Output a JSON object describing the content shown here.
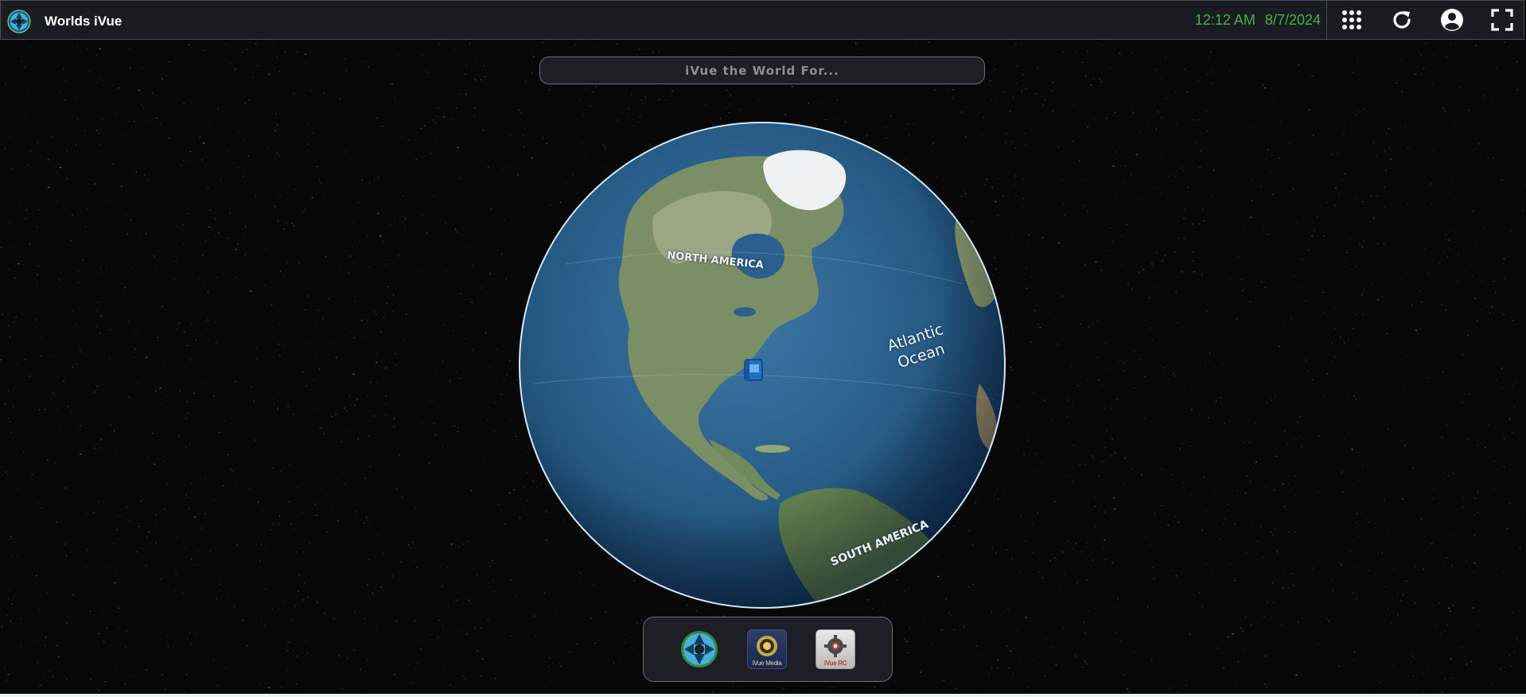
{
  "app": {
    "title": "Worlds iVue"
  },
  "header": {
    "time": "12:12 AM",
    "date": "8/7/2024"
  },
  "search": {
    "placeholder": "iVue the World For..."
  },
  "globe": {
    "labels": {
      "north_america": "NORTH AMERICA",
      "atlantic_line1": "Atlantic",
      "atlantic_line2": "Ocean",
      "south_america": "SOUTH AMERICA"
    }
  },
  "dock": {
    "apps": [
      {
        "caption": ""
      },
      {
        "caption": "iVue Media"
      },
      {
        "caption": "iVue RC"
      }
    ]
  },
  "colors": {
    "clock": "#3fb33f",
    "topbar": "#1b1b23",
    "ocean": "#2a5f8f"
  }
}
